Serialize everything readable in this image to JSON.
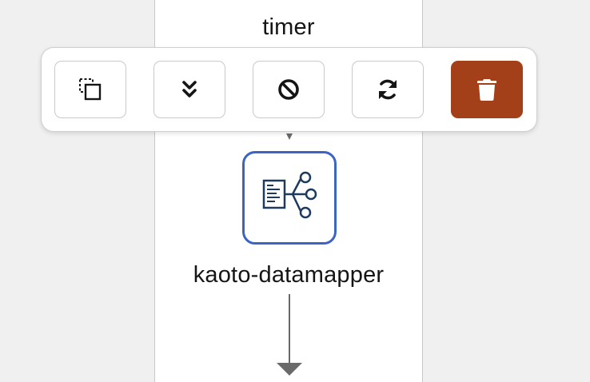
{
  "canvas": {
    "background": "#f0f0f0",
    "route_background": "#ffffff"
  },
  "nodes": {
    "timer": {
      "label": "timer"
    },
    "datamapper": {
      "label": "kaoto-datamapper",
      "icon": "datamapper-icon",
      "border_color": "#3b64c4"
    }
  },
  "toolbar": {
    "buttons": [
      {
        "name": "duplicate",
        "icon": "duplicate-icon"
      },
      {
        "name": "collapse",
        "icon": "chevron-double-down-icon"
      },
      {
        "name": "disable",
        "icon": "ban-icon"
      },
      {
        "name": "replace",
        "icon": "sync-icon"
      },
      {
        "name": "delete",
        "icon": "trash-icon",
        "color": "#a3401a"
      }
    ]
  }
}
